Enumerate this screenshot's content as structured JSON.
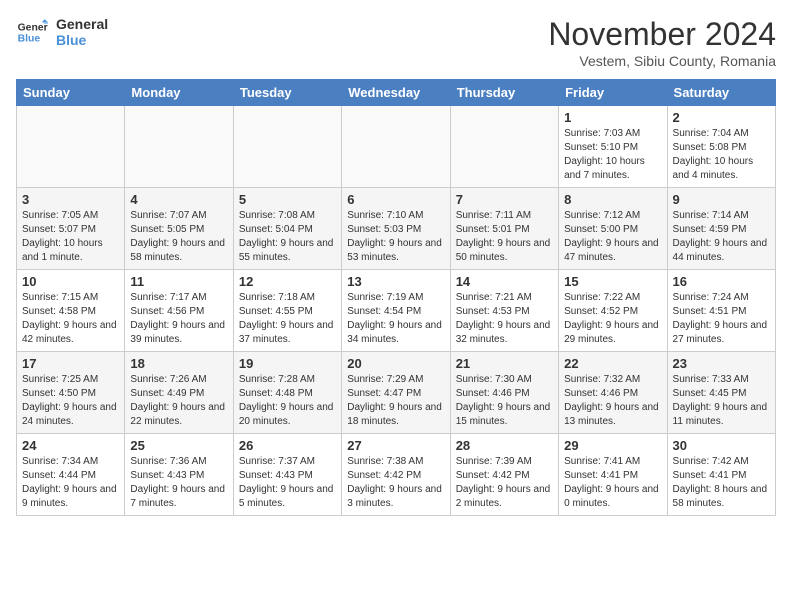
{
  "logo": {
    "line1": "General",
    "line2": "Blue"
  },
  "title": "November 2024",
  "location": "Vestem, Sibiu County, Romania",
  "days_of_week": [
    "Sunday",
    "Monday",
    "Tuesday",
    "Wednesday",
    "Thursday",
    "Friday",
    "Saturday"
  ],
  "weeks": [
    [
      {
        "day": "",
        "info": ""
      },
      {
        "day": "",
        "info": ""
      },
      {
        "day": "",
        "info": ""
      },
      {
        "day": "",
        "info": ""
      },
      {
        "day": "",
        "info": ""
      },
      {
        "day": "1",
        "info": "Sunrise: 7:03 AM\nSunset: 5:10 PM\nDaylight: 10 hours and 7 minutes."
      },
      {
        "day": "2",
        "info": "Sunrise: 7:04 AM\nSunset: 5:08 PM\nDaylight: 10 hours and 4 minutes."
      }
    ],
    [
      {
        "day": "3",
        "info": "Sunrise: 7:05 AM\nSunset: 5:07 PM\nDaylight: 10 hours and 1 minute."
      },
      {
        "day": "4",
        "info": "Sunrise: 7:07 AM\nSunset: 5:05 PM\nDaylight: 9 hours and 58 minutes."
      },
      {
        "day": "5",
        "info": "Sunrise: 7:08 AM\nSunset: 5:04 PM\nDaylight: 9 hours and 55 minutes."
      },
      {
        "day": "6",
        "info": "Sunrise: 7:10 AM\nSunset: 5:03 PM\nDaylight: 9 hours and 53 minutes."
      },
      {
        "day": "7",
        "info": "Sunrise: 7:11 AM\nSunset: 5:01 PM\nDaylight: 9 hours and 50 minutes."
      },
      {
        "day": "8",
        "info": "Sunrise: 7:12 AM\nSunset: 5:00 PM\nDaylight: 9 hours and 47 minutes."
      },
      {
        "day": "9",
        "info": "Sunrise: 7:14 AM\nSunset: 4:59 PM\nDaylight: 9 hours and 44 minutes."
      }
    ],
    [
      {
        "day": "10",
        "info": "Sunrise: 7:15 AM\nSunset: 4:58 PM\nDaylight: 9 hours and 42 minutes."
      },
      {
        "day": "11",
        "info": "Sunrise: 7:17 AM\nSunset: 4:56 PM\nDaylight: 9 hours and 39 minutes."
      },
      {
        "day": "12",
        "info": "Sunrise: 7:18 AM\nSunset: 4:55 PM\nDaylight: 9 hours and 37 minutes."
      },
      {
        "day": "13",
        "info": "Sunrise: 7:19 AM\nSunset: 4:54 PM\nDaylight: 9 hours and 34 minutes."
      },
      {
        "day": "14",
        "info": "Sunrise: 7:21 AM\nSunset: 4:53 PM\nDaylight: 9 hours and 32 minutes."
      },
      {
        "day": "15",
        "info": "Sunrise: 7:22 AM\nSunset: 4:52 PM\nDaylight: 9 hours and 29 minutes."
      },
      {
        "day": "16",
        "info": "Sunrise: 7:24 AM\nSunset: 4:51 PM\nDaylight: 9 hours and 27 minutes."
      }
    ],
    [
      {
        "day": "17",
        "info": "Sunrise: 7:25 AM\nSunset: 4:50 PM\nDaylight: 9 hours and 24 minutes."
      },
      {
        "day": "18",
        "info": "Sunrise: 7:26 AM\nSunset: 4:49 PM\nDaylight: 9 hours and 22 minutes."
      },
      {
        "day": "19",
        "info": "Sunrise: 7:28 AM\nSunset: 4:48 PM\nDaylight: 9 hours and 20 minutes."
      },
      {
        "day": "20",
        "info": "Sunrise: 7:29 AM\nSunset: 4:47 PM\nDaylight: 9 hours and 18 minutes."
      },
      {
        "day": "21",
        "info": "Sunrise: 7:30 AM\nSunset: 4:46 PM\nDaylight: 9 hours and 15 minutes."
      },
      {
        "day": "22",
        "info": "Sunrise: 7:32 AM\nSunset: 4:46 PM\nDaylight: 9 hours and 13 minutes."
      },
      {
        "day": "23",
        "info": "Sunrise: 7:33 AM\nSunset: 4:45 PM\nDaylight: 9 hours and 11 minutes."
      }
    ],
    [
      {
        "day": "24",
        "info": "Sunrise: 7:34 AM\nSunset: 4:44 PM\nDaylight: 9 hours and 9 minutes."
      },
      {
        "day": "25",
        "info": "Sunrise: 7:36 AM\nSunset: 4:43 PM\nDaylight: 9 hours and 7 minutes."
      },
      {
        "day": "26",
        "info": "Sunrise: 7:37 AM\nSunset: 4:43 PM\nDaylight: 9 hours and 5 minutes."
      },
      {
        "day": "27",
        "info": "Sunrise: 7:38 AM\nSunset: 4:42 PM\nDaylight: 9 hours and 3 minutes."
      },
      {
        "day": "28",
        "info": "Sunrise: 7:39 AM\nSunset: 4:42 PM\nDaylight: 9 hours and 2 minutes."
      },
      {
        "day": "29",
        "info": "Sunrise: 7:41 AM\nSunset: 4:41 PM\nDaylight: 9 hours and 0 minutes."
      },
      {
        "day": "30",
        "info": "Sunrise: 7:42 AM\nSunset: 4:41 PM\nDaylight: 8 hours and 58 minutes."
      }
    ]
  ]
}
